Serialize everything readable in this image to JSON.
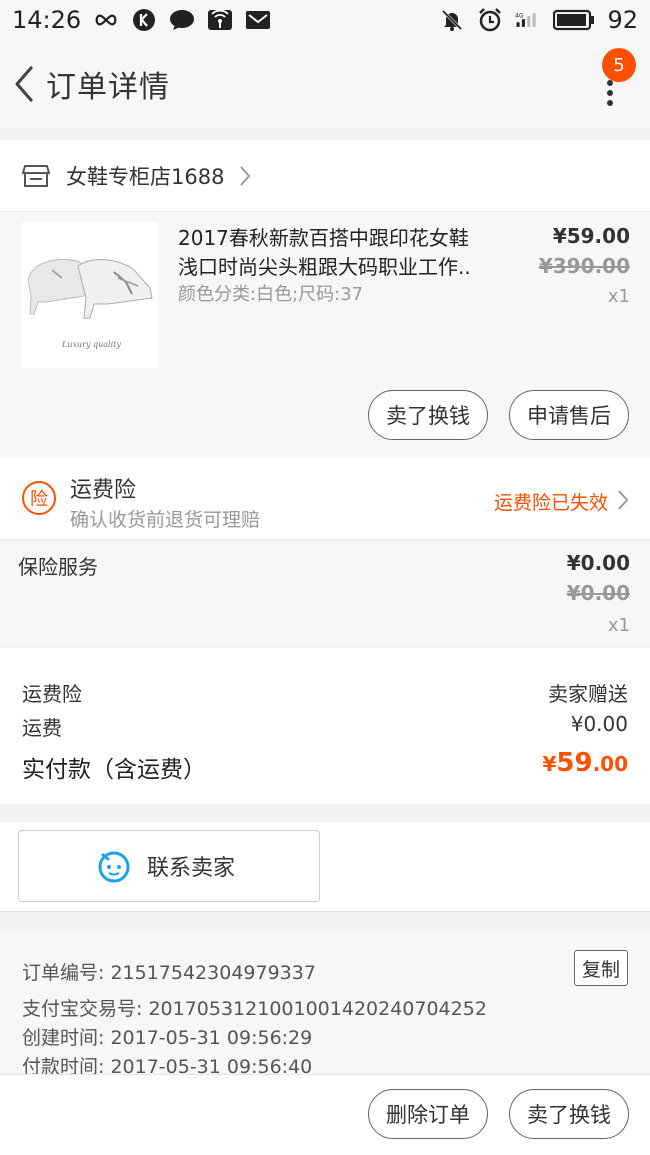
{
  "status_bar": {
    "time": "14:26",
    "battery": "92"
  },
  "header": {
    "title": "订单详情",
    "badge_count": "5"
  },
  "shop": {
    "name": "女鞋专柜店1688"
  },
  "product": {
    "title_line1": "2017春秋新款百搭中跟印花女鞋",
    "title_line2": "浅口时尚尖头粗跟大码职业工作..",
    "sku": "颜色分类:白色;尺码:37",
    "price": "¥59.00",
    "original_price": "¥390.00",
    "quantity": "x1",
    "image_caption": "Luxury quality"
  },
  "product_actions": {
    "sell_label": "卖了换钱",
    "after_sale_label": "申请售后"
  },
  "shipping_insurance": {
    "title": "运费险",
    "subtitle": "确认收货前退货可理赔",
    "status": "运费险已失效",
    "icon_char": "险"
  },
  "insurance_service": {
    "label": "保险服务",
    "price": "¥0.00",
    "original_price": "¥0.00",
    "quantity": "x1"
  },
  "summary": {
    "shipping_ins_label": "运费险",
    "shipping_ins_value": "卖家赠送",
    "shipping_label": "运费",
    "shipping_value": "¥0.00",
    "total_label": "实付款（含运费）",
    "total_currency": "¥",
    "total_int": "59",
    "total_dec": ".00"
  },
  "contact": {
    "label": "联系卖家"
  },
  "order_info": {
    "order_no": "订单编号: 21517542304979337",
    "copy_label": "复制",
    "alipay_no": "支付宝交易号: 2017053121001001420240704252",
    "created": "创建时间: 2017-05-31 09:56:29",
    "paid": "付款时间: 2017-05-31 09:56:40"
  },
  "bottom_actions": {
    "delete_label": "删除订单",
    "sell_label": "卖了换钱"
  },
  "colors": {
    "accent": "#ff5000",
    "blue": "#1aa3e8"
  }
}
